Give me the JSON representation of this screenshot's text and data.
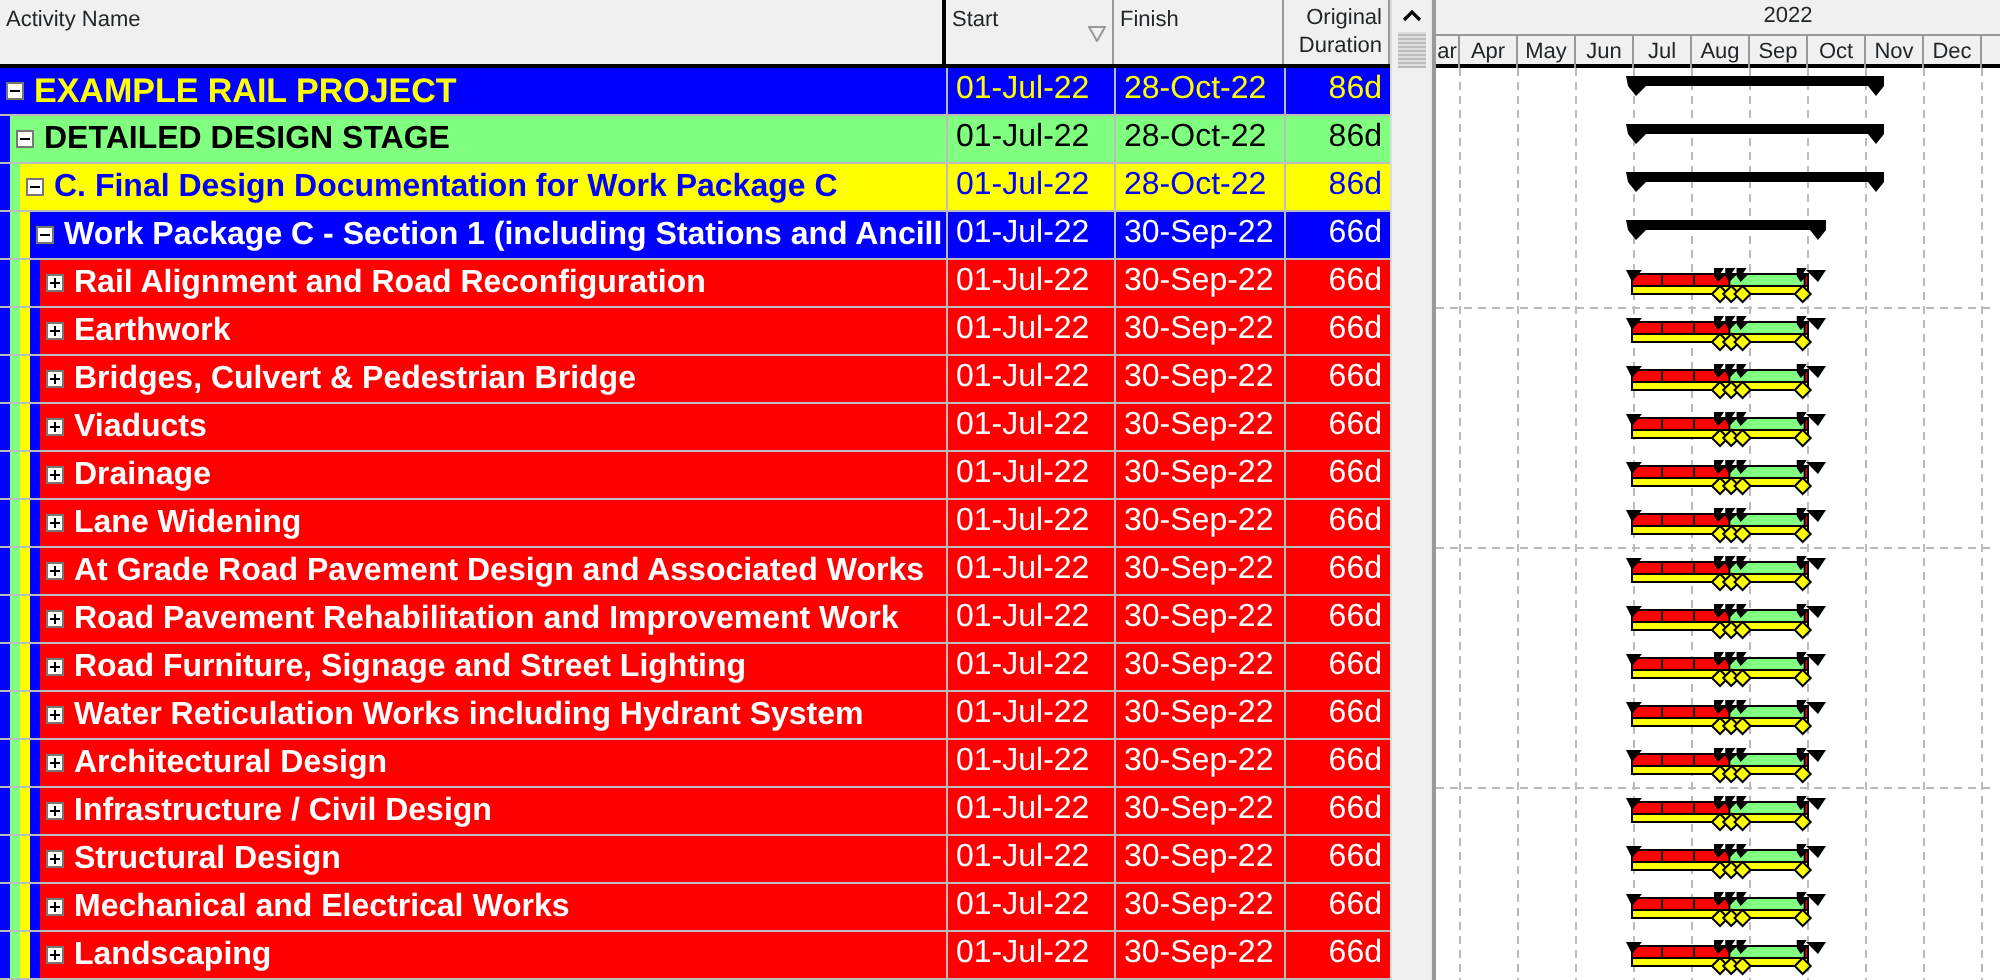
{
  "columns": [
    "Activity Name",
    "Start",
    "Finish",
    "Original Duration"
  ],
  "timeline": {
    "year": "2022",
    "months": [
      "ar",
      "Apr",
      "May",
      "Jun",
      "Jul",
      "Aug",
      "Sep",
      "Oct",
      "Nov",
      "Dec"
    ]
  },
  "activities": [
    {
      "name": "EXAMPLE RAIL PROJECT",
      "start": "01-Jul-22",
      "finish": "28-Oct-22",
      "duration": "86d",
      "expanded": true,
      "children": [
        {
          "name": "DETAILED DESIGN STAGE",
          "start": "01-Jul-22",
          "finish": "28-Oct-22",
          "duration": "86d",
          "expanded": true,
          "children": [
            {
              "name": "C. Final Design Documentation for Work Package C",
              "start": "01-Jul-22",
              "finish": "28-Oct-22",
              "duration": "86d",
              "expanded": true,
              "children": [
                {
                  "name": "Work Package C - Section 1 (including Stations and Ancill",
                  "start": "01-Jul-22",
                  "finish": "30-Sep-22",
                  "duration": "66d",
                  "expanded": true,
                  "children": [
                    {
                      "name": "Rail Alignment and Road Reconfiguration",
                      "start": "01-Jul-22",
                      "finish": "30-Sep-22",
                      "duration": "66d",
                      "expanded": false
                    },
                    {
                      "name": "Earthwork",
                      "start": "01-Jul-22",
                      "finish": "30-Sep-22",
                      "duration": "66d",
                      "expanded": false
                    },
                    {
                      "name": "Bridges, Culvert & Pedestrian Bridge",
                      "start": "01-Jul-22",
                      "finish": "30-Sep-22",
                      "duration": "66d",
                      "expanded": false
                    },
                    {
                      "name": "Viaducts",
                      "start": "01-Jul-22",
                      "finish": "30-Sep-22",
                      "duration": "66d",
                      "expanded": false
                    },
                    {
                      "name": "Drainage",
                      "start": "01-Jul-22",
                      "finish": "30-Sep-22",
                      "duration": "66d",
                      "expanded": false
                    },
                    {
                      "name": "Lane Widening",
                      "start": "01-Jul-22",
                      "finish": "30-Sep-22",
                      "duration": "66d",
                      "expanded": false
                    },
                    {
                      "name": "At Grade Road Pavement Design and Associated Works",
                      "start": "01-Jul-22",
                      "finish": "30-Sep-22",
                      "duration": "66d",
                      "expanded": false
                    },
                    {
                      "name": "Road Pavement Rehabilitation and Improvement Work",
                      "start": "01-Jul-22",
                      "finish": "30-Sep-22",
                      "duration": "66d",
                      "expanded": false
                    },
                    {
                      "name": "Road Furniture, Signage and Street Lighting",
                      "start": "01-Jul-22",
                      "finish": "30-Sep-22",
                      "duration": "66d",
                      "expanded": false
                    },
                    {
                      "name": "Water Reticulation Works including Hydrant System",
                      "start": "01-Jul-22",
                      "finish": "30-Sep-22",
                      "duration": "66d",
                      "expanded": false
                    },
                    {
                      "name": "Architectural Design",
                      "start": "01-Jul-22",
                      "finish": "30-Sep-22",
                      "duration": "66d",
                      "expanded": false
                    },
                    {
                      "name": "Infrastructure / Civil Design",
                      "start": "01-Jul-22",
                      "finish": "30-Sep-22",
                      "duration": "66d",
                      "expanded": false
                    },
                    {
                      "name": "Structural Design",
                      "start": "01-Jul-22",
                      "finish": "30-Sep-22",
                      "duration": "66d",
                      "expanded": false
                    },
                    {
                      "name": "Mechanical and Electrical Works",
                      "start": "01-Jul-22",
                      "finish": "30-Sep-22",
                      "duration": "66d",
                      "expanded": false
                    },
                    {
                      "name": "Landscaping",
                      "start": "01-Jul-22",
                      "finish": "30-Sep-22",
                      "duration": "66d",
                      "expanded": false
                    }
                  ]
                }
              ]
            }
          ]
        }
      ]
    }
  ]
}
